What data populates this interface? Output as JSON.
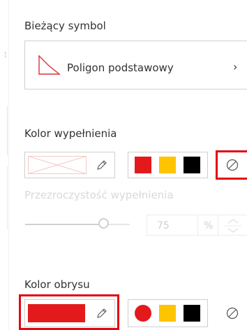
{
  "current_symbol": {
    "label": "Bieżący symbol",
    "symbol_name": "Poligon podstawowy",
    "chevron": "›"
  },
  "fill": {
    "label": "Kolor wypełnienia",
    "preview_icon": "empty-fill-preview",
    "edit_icon": "pencil-icon",
    "swatches": [
      "#e3191b",
      "#ffc400",
      "#000000"
    ],
    "no_color_icon": "no-color-icon"
  },
  "transparency": {
    "label": "Przezroczystość wypełnienia",
    "value": "75",
    "unit": "%",
    "level_percent": 75
  },
  "outline": {
    "label": "Kolor obrysu",
    "preview_color": "#e3191b",
    "edit_icon": "pencil-icon",
    "swatches": [
      "#e3191b",
      "#ffc400",
      "#000000"
    ],
    "no_color_icon": "no-color-icon"
  },
  "colors": {
    "highlight": "#e30613",
    "symbol_icon": "#d9323a"
  }
}
